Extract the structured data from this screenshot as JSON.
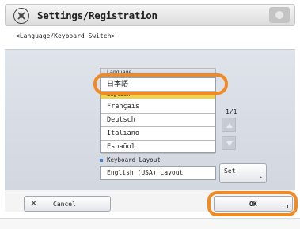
{
  "header": {
    "title": "Settings/Registration",
    "icon": "settings-wrench-icon"
  },
  "subtitle": "<Language/Keyboard Switch>",
  "language_list": {
    "header_label": "Language",
    "items": [
      "日本語",
      "English",
      "Français",
      "Deutsch",
      "Italiano",
      "Español"
    ],
    "selected": "English",
    "page_indicator": "1/1"
  },
  "keyboard": {
    "label": "Keyboard Layout",
    "value": "English (USA) Layout",
    "set_label": "Set"
  },
  "footer": {
    "cancel_label": "Cancel",
    "ok_label": "OK"
  },
  "colors": {
    "highlight_ring": "#f08a24",
    "selected_row": "#efd24a",
    "bullet": "#4a7fc4"
  }
}
